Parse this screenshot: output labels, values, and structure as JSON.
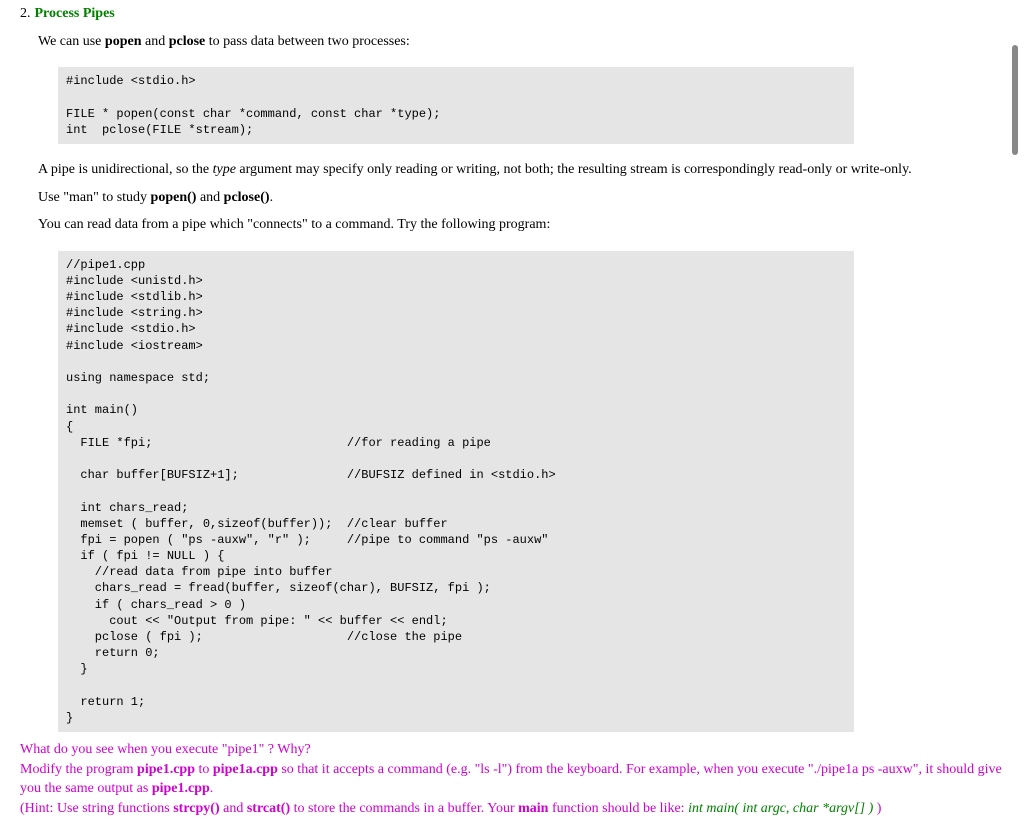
{
  "section": {
    "number": "2.",
    "title": "Process Pipes"
  },
  "p1": {
    "t1": "We can use ",
    "b1": "popen",
    "t2": " and ",
    "b2": "pclose",
    "t3": " to pass data between two processes:"
  },
  "code1": "#include <stdio.h>\n\nFILE * popen(const char *command, const char *type);\nint  pclose(FILE *stream);",
  "p2": {
    "t1": "A pipe is unidirectional, so the ",
    "i1": "type",
    "t2": " argument may specify only reading or writing, not both; the resulting stream is correspondingly read-only or write-only."
  },
  "p3": {
    "t1": "Use \"man\" to study ",
    "b1": "popen()",
    "t2": " and ",
    "b2": "pclose()",
    "t3": "."
  },
  "p4": "You can read data from a pipe which \"connects\" to a command. Try the following program:",
  "code2": "//pipe1.cpp\n#include <unistd.h>\n#include <stdlib.h>\n#include <string.h>\n#include <stdio.h>\n#include <iostream>\n\nusing namespace std;\n\nint main()\n{\n  FILE *fpi;                           //for reading a pipe\n\n  char buffer[BUFSIZ+1];               //BUFSIZ defined in <stdio.h>\n\n  int chars_read;\n  memset ( buffer, 0,sizeof(buffer));  //clear buffer\n  fpi = popen ( \"ps -auxw\", \"r\" );     //pipe to command \"ps -auxw\"\n  if ( fpi != NULL ) {\n    //read data from pipe into buffer\n    chars_read = fread(buffer, sizeof(char), BUFSIZ, fpi );\n    if ( chars_read > 0 )\n      cout << \"Output from pipe: \" << buffer << endl;\n    pclose ( fpi );                    //close the pipe\n    return 0;\n  }\n\n  return 1;\n}",
  "q1": "What do you see when you execute \"pipe1\" ? Why?",
  "q2": {
    "t1": "Modify the program ",
    "b1": "pipe1.cpp",
    "t2": " to ",
    "b2": "pipe1a.cpp",
    "t3": " so that it accepts a command (e.g. \"ls -l\") from the keyboard. For example, when you execute \"./pipe1a ps -auxw\", it should give you the same output as ",
    "b3": "pipe1.cpp",
    "t4": "."
  },
  "q3": {
    "t1": "(Hint: Use string functions ",
    "b1": "strcpy()",
    "t2": " and ",
    "b2": "strcat()",
    "t3": " to store the commands in a buffer. Your ",
    "b3": "main",
    "t4": " function should be like: ",
    "sig": "int main( int argc, char *argv[] )",
    "t5": " )"
  }
}
